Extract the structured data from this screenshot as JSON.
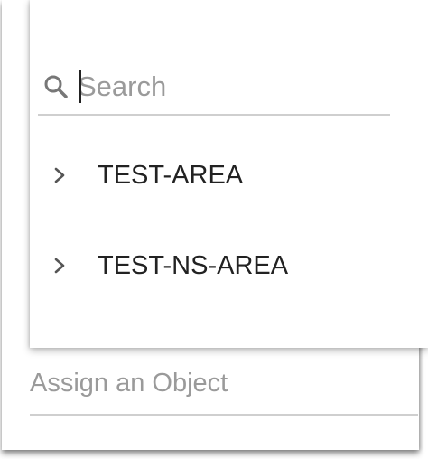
{
  "search": {
    "placeholder": "Search",
    "icon": "search-icon"
  },
  "tree": {
    "items": [
      {
        "label": "TEST-AREA",
        "icon": "chevron-right-icon"
      },
      {
        "label": "TEST-NS-AREA",
        "icon": "chevron-right-icon"
      }
    ]
  },
  "assign_field": {
    "placeholder": "Assign an Object"
  },
  "colors": {
    "underline": "#cfcfcf",
    "placeholder_text": "#9a9a9a",
    "item_text": "#222222",
    "icon": "#777777"
  }
}
